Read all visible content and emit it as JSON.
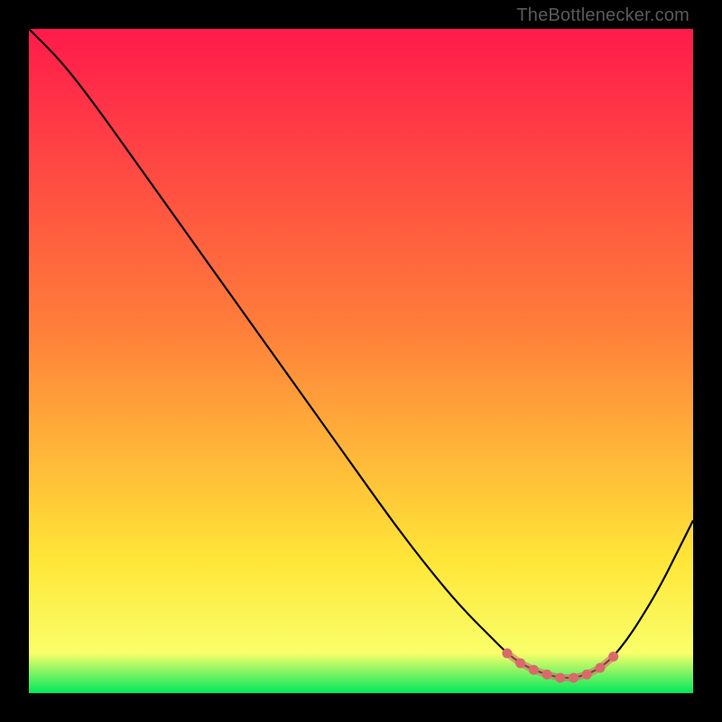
{
  "watermark": "TheBottlenecker.com",
  "colors": {
    "bg": "#000000",
    "grad_top": "#ff1a4b",
    "grad_mid_top": "#ff7e3a",
    "grad_mid": "#ffe638",
    "grad_low": "#f9ff6a",
    "grad_base": "#00e85c",
    "curve": "#000000",
    "marker": "#d86a6c"
  },
  "chart_data": {
    "type": "line",
    "title": "",
    "xlabel": "",
    "ylabel": "",
    "xlim": [
      0,
      100
    ],
    "ylim": [
      0,
      100
    ],
    "series": [
      {
        "name": "curve",
        "x": [
          0,
          5,
          10,
          15,
          20,
          25,
          30,
          35,
          40,
          45,
          50,
          55,
          60,
          65,
          70,
          72,
          74,
          76,
          78,
          80,
          82,
          84,
          86,
          88,
          90,
          92,
          95,
          98,
          100
        ],
        "values": [
          100,
          95,
          88.5,
          81.5,
          74.5,
          67.5,
          60.5,
          53.5,
          46.5,
          39.5,
          32.5,
          25.5,
          19,
          13,
          8,
          6,
          4.5,
          3.5,
          2.8,
          2.3,
          2.3,
          2.8,
          3.8,
          5.5,
          8,
          11,
          16,
          22,
          26
        ]
      }
    ],
    "highlight": {
      "name": "bottleneck-range",
      "x": [
        72,
        74,
        76,
        78,
        80,
        82,
        84,
        86,
        88
      ],
      "values": [
        6,
        4.5,
        3.5,
        2.8,
        2.3,
        2.3,
        2.8,
        3.8,
        5.5
      ]
    }
  }
}
